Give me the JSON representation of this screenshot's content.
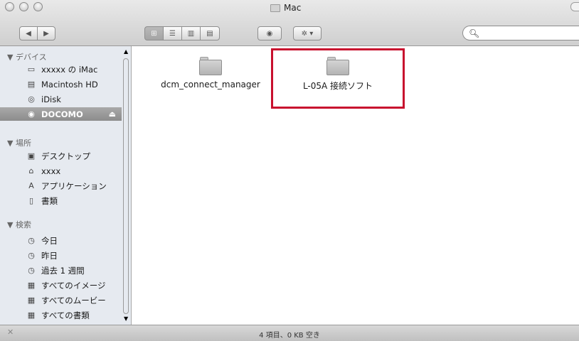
{
  "window": {
    "title": "Mac"
  },
  "toolbar": {
    "back_icon": "back-arrow-icon",
    "forward_icon": "forward-arrow-icon",
    "views": [
      {
        "name": "icon-view",
        "active": true
      },
      {
        "name": "list-view",
        "active": false
      },
      {
        "name": "column-view",
        "active": false
      },
      {
        "name": "coverflow-view",
        "active": false
      }
    ],
    "quicklook_icon": "eye-icon",
    "action_icon": "gear-icon",
    "search": {
      "placeholder": "",
      "icon": "search-icon"
    }
  },
  "sidebar": {
    "sections": [
      {
        "heading": "▼ デバイス",
        "items": [
          {
            "label": "xxxxx の iMac",
            "icon": "imac-icon"
          },
          {
            "label": "Macintosh HD",
            "icon": "hard-drive-icon"
          },
          {
            "label": "iDisk",
            "icon": "idisk-icon"
          },
          {
            "label": "DOCOMO",
            "icon": "disk-icon",
            "selected": true,
            "eject": "⏏"
          }
        ]
      },
      {
        "heading": "▼ 場所",
        "items": [
          {
            "label": "デスクトップ",
            "icon": "desktop-icon"
          },
          {
            "label": "xxxx",
            "icon": "home-icon"
          },
          {
            "label": "アプリケーション",
            "icon": "applications-icon"
          },
          {
            "label": "書類",
            "icon": "documents-icon"
          }
        ]
      },
      {
        "heading": "▼ 検索",
        "items": [
          {
            "label": "今日",
            "icon": "clock-icon"
          },
          {
            "label": "昨日",
            "icon": "clock-icon"
          },
          {
            "label": "過去 1 週間",
            "icon": "clock-icon"
          },
          {
            "label": "すべてのイメージ",
            "icon": "smart-folder-icon"
          },
          {
            "label": "すべてのムービー",
            "icon": "smart-folder-icon"
          },
          {
            "label": "すべての書類",
            "icon": "smart-folder-icon"
          }
        ]
      }
    ]
  },
  "files": [
    {
      "name": "dcm_connect_manager",
      "icon": "folder-icon"
    },
    {
      "name": "L-05A 接続ソフト",
      "icon": "folder-icon",
      "highlighted": true
    }
  ],
  "status": {
    "text": "4 項目、0 KB 空き"
  },
  "colors": {
    "highlight": "#c8102e",
    "sidebar_bg": "#e6eaf0"
  }
}
